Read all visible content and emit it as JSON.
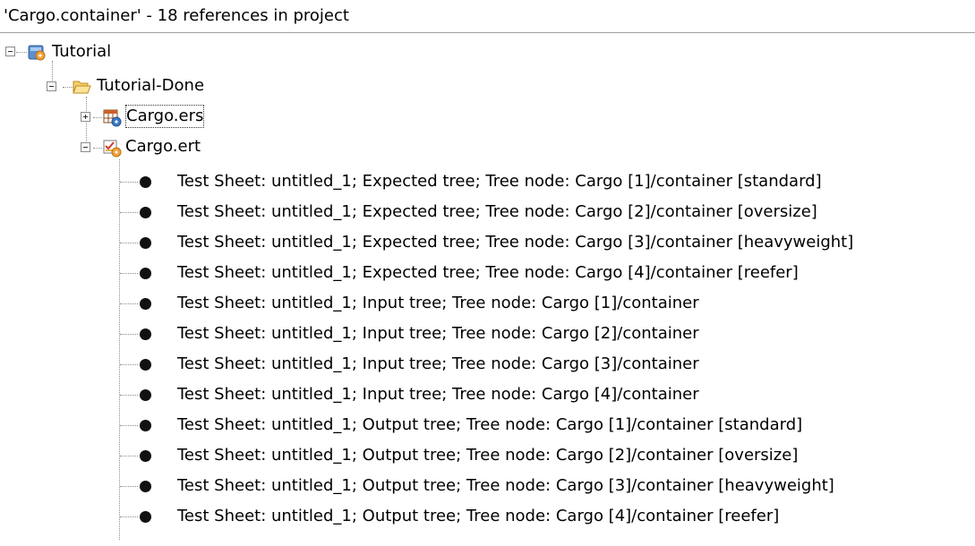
{
  "header": {
    "title": "'Cargo.container' - 18 references in project"
  },
  "tree": {
    "project": {
      "label": "Tutorial",
      "icon": "project-icon"
    },
    "folder": {
      "label": "Tutorial-Done",
      "icon": "open-folder-icon"
    },
    "files": [
      {
        "label": "Cargo.ers",
        "icon": "ers-file-icon",
        "expanded": false
      },
      {
        "label": "Cargo.ert",
        "icon": "ert-file-icon",
        "expanded": true
      }
    ],
    "references": [
      "Test Sheet: untitled_1; Expected tree; Tree node: Cargo [1]/container [standard]",
      "Test Sheet: untitled_1; Expected tree; Tree node: Cargo [2]/container [oversize]",
      "Test Sheet: untitled_1; Expected tree; Tree node: Cargo [3]/container [heavyweight]",
      "Test Sheet: untitled_1; Expected tree; Tree node: Cargo [4]/container [reefer]",
      "Test Sheet: untitled_1; Input tree; Tree node: Cargo [1]/container",
      "Test Sheet: untitled_1; Input tree; Tree node: Cargo [2]/container",
      "Test Sheet: untitled_1; Input tree; Tree node: Cargo [3]/container",
      "Test Sheet: untitled_1; Input tree; Tree node: Cargo [4]/container",
      "Test Sheet: untitled_1; Output tree; Tree node: Cargo [1]/container [standard]",
      "Test Sheet: untitled_1; Output tree; Tree node: Cargo [2]/container [oversize]",
      "Test Sheet: untitled_1; Output tree; Tree node: Cargo [3]/container [heavyweight]",
      "Test Sheet: untitled_1; Output tree; Tree node: Cargo [4]/container [reefer]"
    ]
  }
}
